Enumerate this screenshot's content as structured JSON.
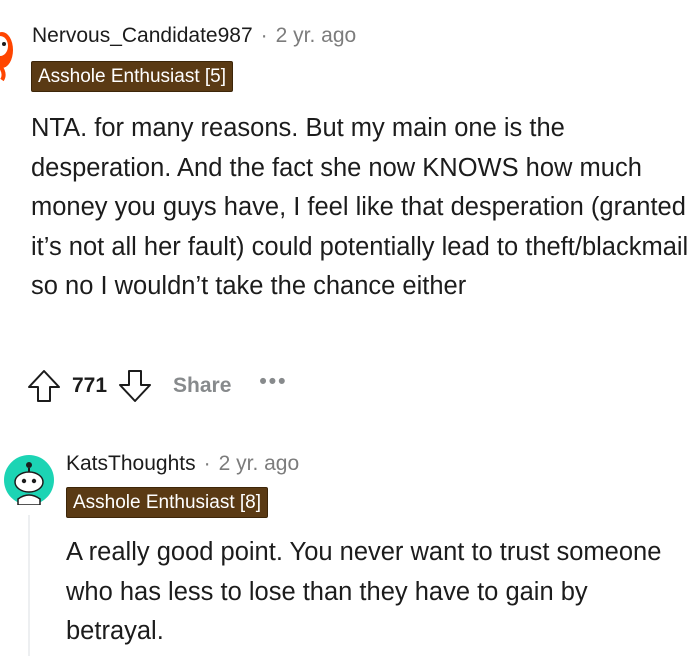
{
  "comments": [
    {
      "username": "Nervous_Candidate987",
      "time": "2 yr. ago",
      "flair": "Asshole Enthusiast [5]",
      "body": "NTA. for many reasons. But my main one is the desperation. And the fact she now KNOWS how much money you guys have, I feel like that desperation (granted it’s not all her fault) could potentially lead to theft/blackmail so no I wouldn’t take the chance either",
      "score": "771",
      "share_label": "Share",
      "more_label": "•••"
    },
    {
      "username": "KatsThoughts",
      "time": "2 yr. ago",
      "flair": "Asshole Enthusiast [8]",
      "body": "A really good point. You never want to trust someone who has less to lose than they have to gain by betrayal."
    }
  ],
  "separator": "·",
  "icons": {
    "avatar1": "snoo-avatar-orange",
    "avatar2": "snoo-avatar-teal",
    "upvote": "upvote-arrow-icon",
    "downvote": "downvote-arrow-icon",
    "more": "more-options-icon"
  },
  "colors": {
    "flair_bg": "#5a3a14",
    "teal_avatar": "#1cd4b4",
    "meta_gray": "#7c7c7c"
  }
}
